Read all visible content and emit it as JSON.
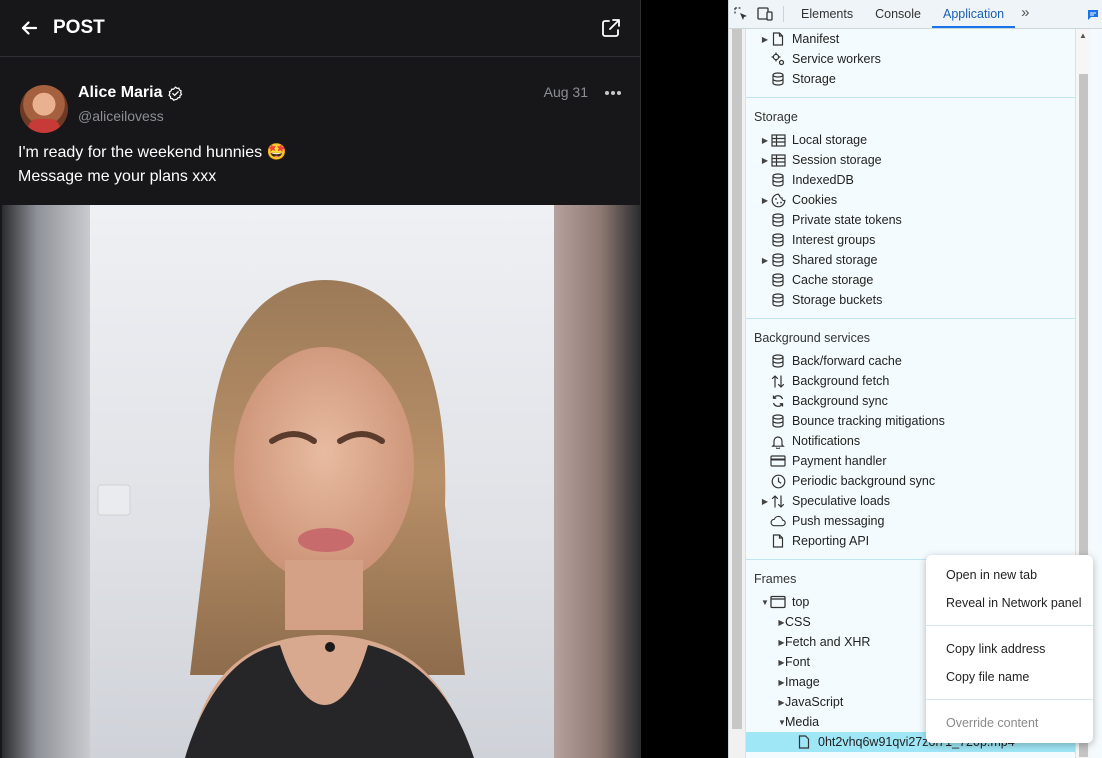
{
  "app": {
    "header_title": "POST",
    "post": {
      "author_name": "Alice Maria",
      "handle": "@aliceilovess",
      "date": "Aug 31",
      "text_line1": "I'm ready for the weekend hunnies 🤩",
      "text_line2": "Message me your plans xxx"
    }
  },
  "devtools": {
    "tabs": [
      "Elements",
      "Console",
      "Application"
    ],
    "active_tab": "Application",
    "application_items": [
      {
        "label": "Manifest",
        "icon": "file-icon",
        "expandable": true
      },
      {
        "label": "Service workers",
        "icon": "gears-icon",
        "expandable": false
      },
      {
        "label": "Storage",
        "icon": "database-icon",
        "expandable": false
      }
    ],
    "storage_title": "Storage",
    "storage_items": [
      {
        "label": "Local storage",
        "icon": "table-icon",
        "expandable": true
      },
      {
        "label": "Session storage",
        "icon": "table-icon",
        "expandable": true
      },
      {
        "label": "IndexedDB",
        "icon": "database-icon",
        "expandable": false
      },
      {
        "label": "Cookies",
        "icon": "cookie-icon",
        "expandable": true
      },
      {
        "label": "Private state tokens",
        "icon": "database-icon",
        "expandable": false
      },
      {
        "label": "Interest groups",
        "icon": "database-icon",
        "expandable": false
      },
      {
        "label": "Shared storage",
        "icon": "database-icon",
        "expandable": true
      },
      {
        "label": "Cache storage",
        "icon": "database-icon",
        "expandable": false
      },
      {
        "label": "Storage buckets",
        "icon": "database-icon",
        "expandable": false
      }
    ],
    "background_title": "Background services",
    "background_items": [
      {
        "label": "Back/forward cache",
        "icon": "database-icon",
        "expandable": false
      },
      {
        "label": "Background fetch",
        "icon": "updown-icon",
        "expandable": false
      },
      {
        "label": "Background sync",
        "icon": "sync-icon",
        "expandable": false
      },
      {
        "label": "Bounce tracking mitigations",
        "icon": "database-icon",
        "expandable": false
      },
      {
        "label": "Notifications",
        "icon": "bell-icon",
        "expandable": false
      },
      {
        "label": "Payment handler",
        "icon": "card-icon",
        "expandable": false
      },
      {
        "label": "Periodic background sync",
        "icon": "clock-icon",
        "expandable": false
      },
      {
        "label": "Speculative loads",
        "icon": "updown-icon",
        "expandable": true
      },
      {
        "label": "Push messaging",
        "icon": "cloud-icon",
        "expandable": false
      },
      {
        "label": "Reporting API",
        "icon": "file-icon",
        "expandable": false
      }
    ],
    "frames_title": "Frames",
    "frames": {
      "top_label": "top",
      "children": [
        "CSS",
        "Fetch and XHR",
        "Font",
        "Image",
        "JavaScript",
        "Media"
      ],
      "selected_file": "0ht2vhq6w91qvi27zol71_720p.mp4"
    }
  },
  "context_menu": {
    "items_group1": [
      "Open in new tab",
      "Reveal in Network panel"
    ],
    "items_group2": [
      "Copy link address",
      "Copy file name"
    ],
    "items_group3": [
      "Override content"
    ]
  }
}
